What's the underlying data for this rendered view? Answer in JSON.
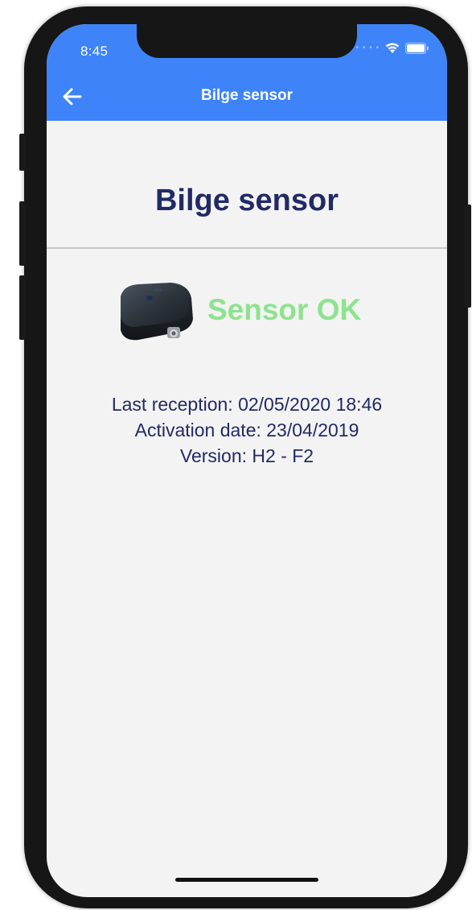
{
  "status_bar": {
    "time": "8:45",
    "signal_icon": "signal-dots-icon",
    "wifi_icon": "wifi-icon",
    "battery_icon": "battery-icon"
  },
  "app_bar": {
    "back_icon": "arrow-left-icon",
    "title": "Bilge sensor"
  },
  "page": {
    "heading": "Bilge sensor",
    "device_image": "bilge-sensor-device-icon",
    "status": "Sensor OK",
    "info": {
      "last_reception": "Last reception: 02/05/2020 18:46",
      "activation_date": "Activation date: 23/04/2019",
      "version": "Version: H2 - F2"
    }
  },
  "colors": {
    "app_bar": "#3e84f8",
    "heading_text": "#222a66",
    "status_ok": "#8ee38e",
    "background": "#f3f3f3"
  }
}
